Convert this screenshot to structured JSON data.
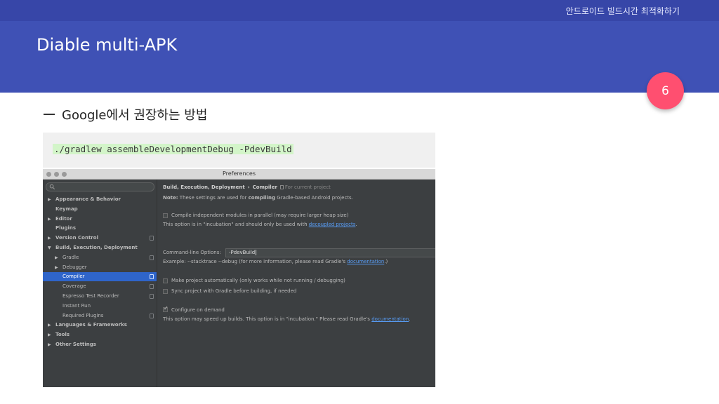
{
  "slide": {
    "course_title": "안드로이드 빌드시간 최적화하기",
    "title": "Diable multi-APK",
    "page_number": "6",
    "bullet": "Google에서 권장하는 방법",
    "code": "./gradlew assembleDevelopmentDebug -PdevBuild",
    "colors": {
      "header": "#3f51b5",
      "topbar": "#3746a8",
      "badge": "#ff4f70",
      "code_highlight": "#d3f5c9"
    }
  },
  "preferences": {
    "window_title": "Preferences",
    "search_placeholder": "",
    "tree": [
      {
        "label": "Appearance & Behavior",
        "level": 0,
        "arrow": "▶",
        "bold": true
      },
      {
        "label": "Keymap",
        "level": 0,
        "arrow": "",
        "bold": true
      },
      {
        "label": "Editor",
        "level": 0,
        "arrow": "▶",
        "bold": true
      },
      {
        "label": "Plugins",
        "level": 0,
        "arrow": "",
        "bold": true
      },
      {
        "label": "Version Control",
        "level": 0,
        "arrow": "▶",
        "bold": true,
        "icon": true
      },
      {
        "label": "Build, Execution, Deployment",
        "level": 0,
        "arrow": "▼",
        "bold": true
      },
      {
        "label": "Gradle",
        "level": 1,
        "arrow": "▶",
        "icon": true
      },
      {
        "label": "Debugger",
        "level": 1,
        "arrow": "▶"
      },
      {
        "label": "Compiler",
        "level": 1,
        "arrow": "",
        "selected": true,
        "icon": true
      },
      {
        "label": "Coverage",
        "level": 1,
        "arrow": "",
        "icon": true
      },
      {
        "label": "Espresso Test Recorder",
        "level": 1,
        "arrow": "",
        "icon": true
      },
      {
        "label": "Instant Run",
        "level": 1,
        "arrow": ""
      },
      {
        "label": "Required Plugins",
        "level": 1,
        "arrow": "",
        "icon": true
      },
      {
        "label": "Languages & Frameworks",
        "level": 0,
        "arrow": "▶",
        "bold": true
      },
      {
        "label": "Tools",
        "level": 0,
        "arrow": "▶",
        "bold": true
      },
      {
        "label": "Other Settings",
        "level": 0,
        "arrow": "▶",
        "bold": true
      }
    ],
    "breadcrumb": {
      "part1": "Build, Execution, Deployment",
      "separator": "›",
      "part2": "Compiler",
      "scope": "For current project"
    },
    "note": {
      "label": "Note:",
      "text_before": " These settings are used for ",
      "bold_word": "compiling",
      "text_after": " Gradle-based Android projects."
    },
    "option_parallel": {
      "label": "Compile independent modules in parallel (may require larger heap size)",
      "checked": false,
      "desc_before": "This option is in \"incubation\" and should only be used with ",
      "desc_link": "decoupled projects",
      "desc_after": "."
    },
    "command_line": {
      "label": "Command-line Options:",
      "value": "-PdevBuild",
      "example_before": "Example: --stacktrace --debug (for more information, please read Gradle's ",
      "example_link": "documentation",
      "example_after": ".)"
    },
    "option_make_auto": {
      "label": "Make project automatically (only works while not running / debugging)",
      "checked": false
    },
    "option_sync": {
      "label": "Sync project with Gradle before building, if needed",
      "checked": false
    },
    "option_configure": {
      "label": "Configure on demand",
      "checked": true,
      "desc_before": "This option may speed up builds. This option is in \"incubation.\" Please read Gradle's ",
      "desc_link": "documentation",
      "desc_after": "."
    }
  }
}
